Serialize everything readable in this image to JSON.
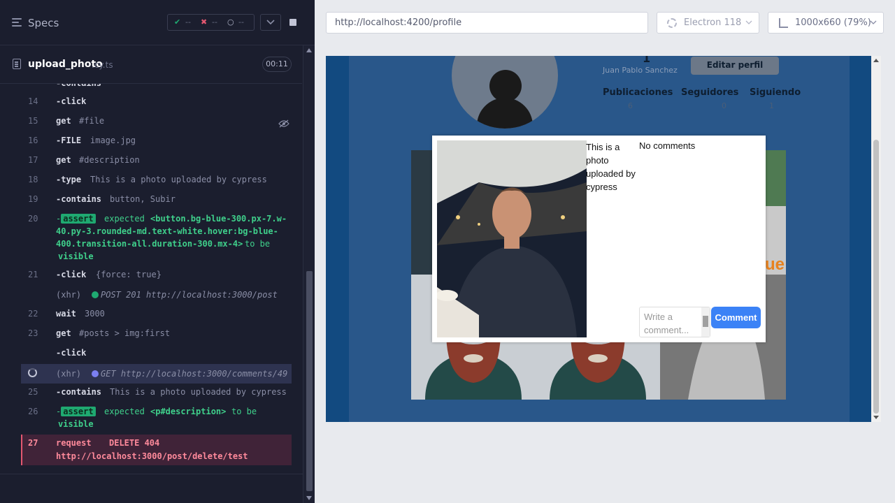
{
  "reporter": {
    "title": "Specs",
    "stats": {
      "passed": "--",
      "failed": "--",
      "pending": "--"
    },
    "spec": {
      "name": "upload_photo",
      "ext": ".cy.ts",
      "duration": "00:11"
    },
    "commands": [
      {
        "ln": "14",
        "name": "-click",
        "msg": ""
      },
      {
        "ln": "15",
        "name": "get",
        "msg": "#file"
      },
      {
        "ln": "16",
        "name": "-FILE",
        "msg": "image.jpg"
      },
      {
        "ln": "17",
        "name": "get",
        "msg": "#description"
      },
      {
        "ln": "18",
        "name": "-type",
        "msg": "This is a photo uploaded by cypress"
      },
      {
        "ln": "19",
        "name": "-contains",
        "msg": "button, Subir"
      },
      {
        "ln": "20",
        "badge": "assert",
        "l1": "expected",
        "l1b": "<button.bg-blue-300.px-7.w-",
        "l2": "40.py-3.rounded-md.text-white.hover:bg-blue-",
        "l3": "400.transition-all.duration-300.mx-4>",
        "l3b": "to be",
        "l4": "visible"
      },
      {
        "ln": "21",
        "name": "-click",
        "msg": "{force: true}"
      },
      {
        "ln": "",
        "name": "(xhr)",
        "msg": "POST 201 http://localhost:3000/post"
      },
      {
        "ln": "22",
        "name": "wait",
        "msg": "3000"
      },
      {
        "ln": "23",
        "name": "get",
        "msg": "#posts > img:first"
      },
      {
        "ln": "",
        "name": "-click",
        "msg": ""
      },
      {
        "ln": "",
        "name": "(xhr)",
        "msg": "GET http://localhost:3000/comments/49"
      },
      {
        "ln": "25",
        "name": "-contains",
        "msg": "This is a photo uploaded by cypress"
      },
      {
        "ln": "26",
        "badge": "assert",
        "l1": "expected",
        "l1b": "<p#description>",
        "l1c": "to be",
        "l2": "visible"
      },
      {
        "ln": "27",
        "name": "request",
        "msg": "DELETE 404",
        "l2": "http://localhost:3000/post/delete/test"
      }
    ]
  },
  "browser": {
    "url": "http://localhost:4200/profile",
    "engine": "Electron 118",
    "viewport": "1000x660",
    "zoom": "(79%)"
  },
  "profile": {
    "count": "1",
    "name": "Juan Pablo Sanchez",
    "edit_label": "Editar perfil",
    "stats": [
      {
        "label": "Publicaciones",
        "value": "6"
      },
      {
        "label": "Seguidores",
        "value": "0"
      },
      {
        "label": "Siguiendo",
        "value": "1"
      }
    ]
  },
  "modal": {
    "description": "This is a photo uploaded by cypress",
    "no_comments": "No comments",
    "comment_placeholder": "Write a comment...",
    "comment_button": "Comment"
  },
  "colors": {
    "pass": "#1fa971",
    "fail": "#e45770",
    "accent": "#3b82f6"
  }
}
